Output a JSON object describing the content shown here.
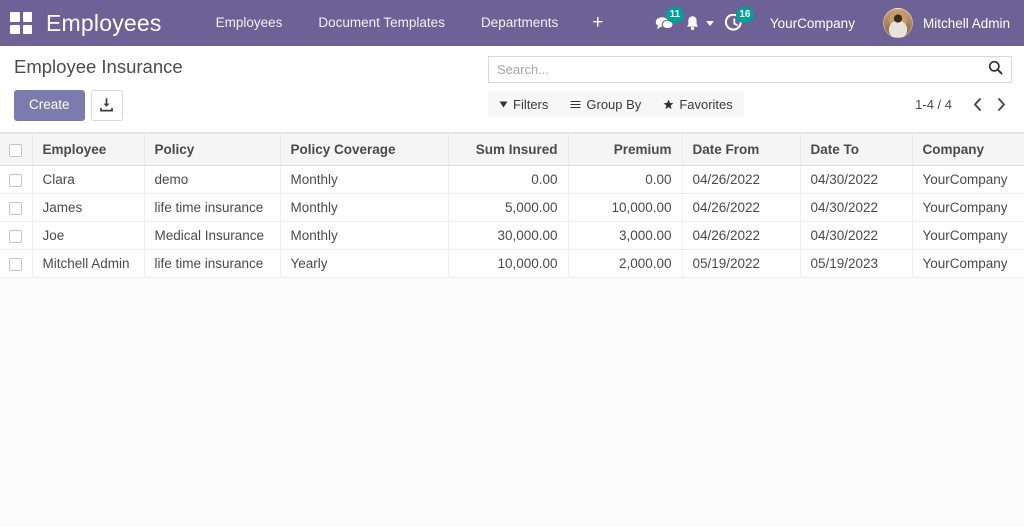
{
  "navbar": {
    "apps_icon": "apps-grid-icon",
    "brand": "Employees",
    "menu": [
      {
        "label": "Employees"
      },
      {
        "label": "Document Templates"
      },
      {
        "label": "Departments"
      }
    ],
    "add_label": "+",
    "messages": {
      "icon": "chat-icon",
      "badge": "11"
    },
    "activities_notify": {
      "icon": "bell-icon"
    },
    "clock": {
      "icon": "clock-icon",
      "badge": "16"
    },
    "company": "YourCompany",
    "user": "Mitchell Admin",
    "avatar_icon": "avatar",
    "background_color": "#6c6296",
    "badge_color": "#00a09d"
  },
  "control_panel": {
    "title": "Employee Insurance",
    "create_label": "Create",
    "import_icon": "import-icon",
    "search": {
      "placeholder": "Search...",
      "value": "",
      "icon": "search-icon"
    },
    "filters": [
      {
        "label": "Filters",
        "icon": "filter-caret-icon"
      },
      {
        "label": "Group By",
        "icon": "group-lines-icon"
      },
      {
        "label": "Favorites",
        "icon": "star-icon"
      }
    ],
    "pager": {
      "range": "1-4 / 4",
      "prev_icon": "chevron-left-icon",
      "next_icon": "chevron-right-icon"
    },
    "create_button_color": "#7c7bad"
  },
  "table": {
    "columns": [
      {
        "label": "Employee",
        "align": "left"
      },
      {
        "label": "Policy",
        "align": "left"
      },
      {
        "label": "Policy Coverage",
        "align": "left"
      },
      {
        "label": "Sum Insured",
        "align": "right"
      },
      {
        "label": "Premium",
        "align": "right"
      },
      {
        "label": "Date From",
        "align": "left"
      },
      {
        "label": "Date To",
        "align": "left"
      },
      {
        "label": "Company",
        "align": "left"
      }
    ],
    "rows": [
      {
        "employee": "Clara",
        "policy": "demo",
        "coverage": "Monthly",
        "sum_insured": "0.00",
        "premium": "0.00",
        "date_from": "04/26/2022",
        "date_to": "04/30/2022",
        "company": "YourCompany"
      },
      {
        "employee": "James",
        "policy": "life time insurance",
        "coverage": "Monthly",
        "sum_insured": "5,000.00",
        "premium": "10,000.00",
        "date_from": "04/26/2022",
        "date_to": "04/30/2022",
        "company": "YourCompany"
      },
      {
        "employee": "Joe",
        "policy": "Medical Insurance",
        "coverage": "Monthly",
        "sum_insured": "30,000.00",
        "premium": "3,000.00",
        "date_from": "04/26/2022",
        "date_to": "04/30/2022",
        "company": "YourCompany"
      },
      {
        "employee": "Mitchell Admin",
        "policy": "life time insurance",
        "coverage": "Yearly",
        "sum_insured": "10,000.00",
        "premium": "2,000.00",
        "date_from": "05/19/2022",
        "date_to": "05/19/2023",
        "company": "YourCompany"
      }
    ]
  }
}
